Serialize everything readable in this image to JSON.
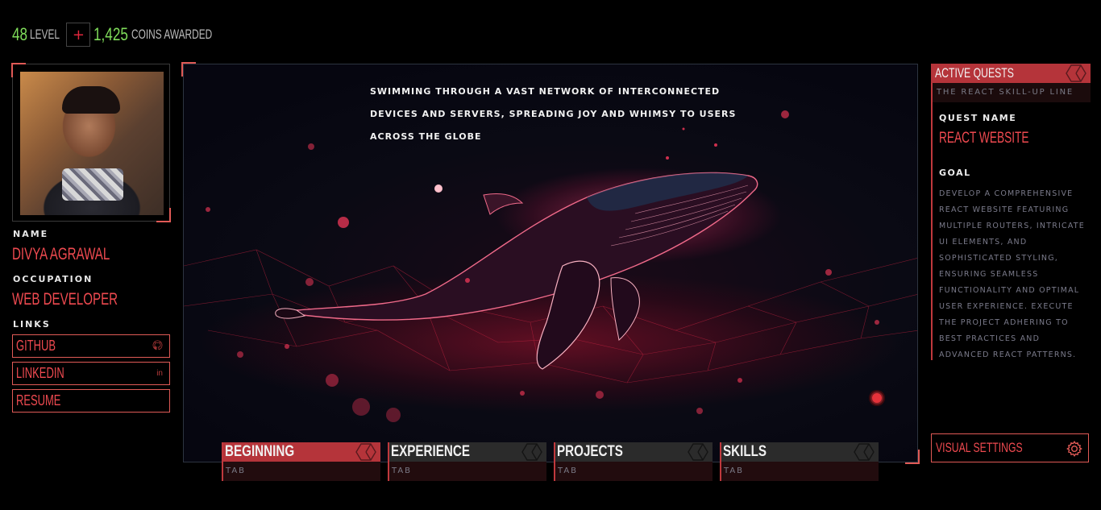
{
  "stats": {
    "level_value": "48",
    "level_label": "LEVEL",
    "plus": "+",
    "coins_value": "1,425",
    "coins_label": "COINS AWARDED"
  },
  "profile": {
    "name_label": "NAME",
    "name": "DIVYA AGRAWAL",
    "occupation_label": "OCCUPATION",
    "occupation": "WEB DEVELOPER",
    "links_label": "LINKS",
    "links": [
      {
        "label": "GITHUB",
        "icon": "github-icon"
      },
      {
        "label": "LINKEDIN",
        "icon": "linkedin-icon"
      },
      {
        "label": "RESUME",
        "icon": ""
      }
    ]
  },
  "main": {
    "caption": "SWIMMING THROUGH A VAST NETWORK OF INTERCONNECTED DEVICES AND SERVERS, SPREADING JOY AND WHIMSY TO USERS ACROSS THE GLOBE",
    "accent": "#e4323a"
  },
  "tabs": [
    {
      "name": "BEGINNING",
      "sub": "TAB",
      "active": true
    },
    {
      "name": "EXPERIENCE",
      "sub": "TAB",
      "active": false
    },
    {
      "name": "PROJECTS",
      "sub": "TAB",
      "active": false
    },
    {
      "name": "SKILLS",
      "sub": "TAB",
      "active": false
    }
  ],
  "quests": {
    "title": "ACTIVE QUESTS",
    "line": "THE REACT SKILL-UP LINE",
    "quest_name_label": "QUEST NAME",
    "quest_name": "REACT WEBSITE",
    "goal_label": "GOAL",
    "goal": "DEVELOP A COMPREHENSIVE REACT WEBSITE FEATURING MULTIPLE ROUTERS, INTRICATE UI ELEMENTS, AND SOPHISTICATED STYLING, ENSURING SEAMLESS FUNCTIONALITY AND OPTIMAL USER EXPERIENCE. EXECUTE THE PROJECT ADHERING TO BEST PRACTICES AND ADVANCED REACT PATTERNS."
  },
  "settings": {
    "label": "VISUAL SETTINGS",
    "icon": "gear-icon"
  },
  "colors": {
    "accent_red": "#ef4a50",
    "level_green": "#7fdc5a",
    "tab_active": "#b5343a"
  }
}
